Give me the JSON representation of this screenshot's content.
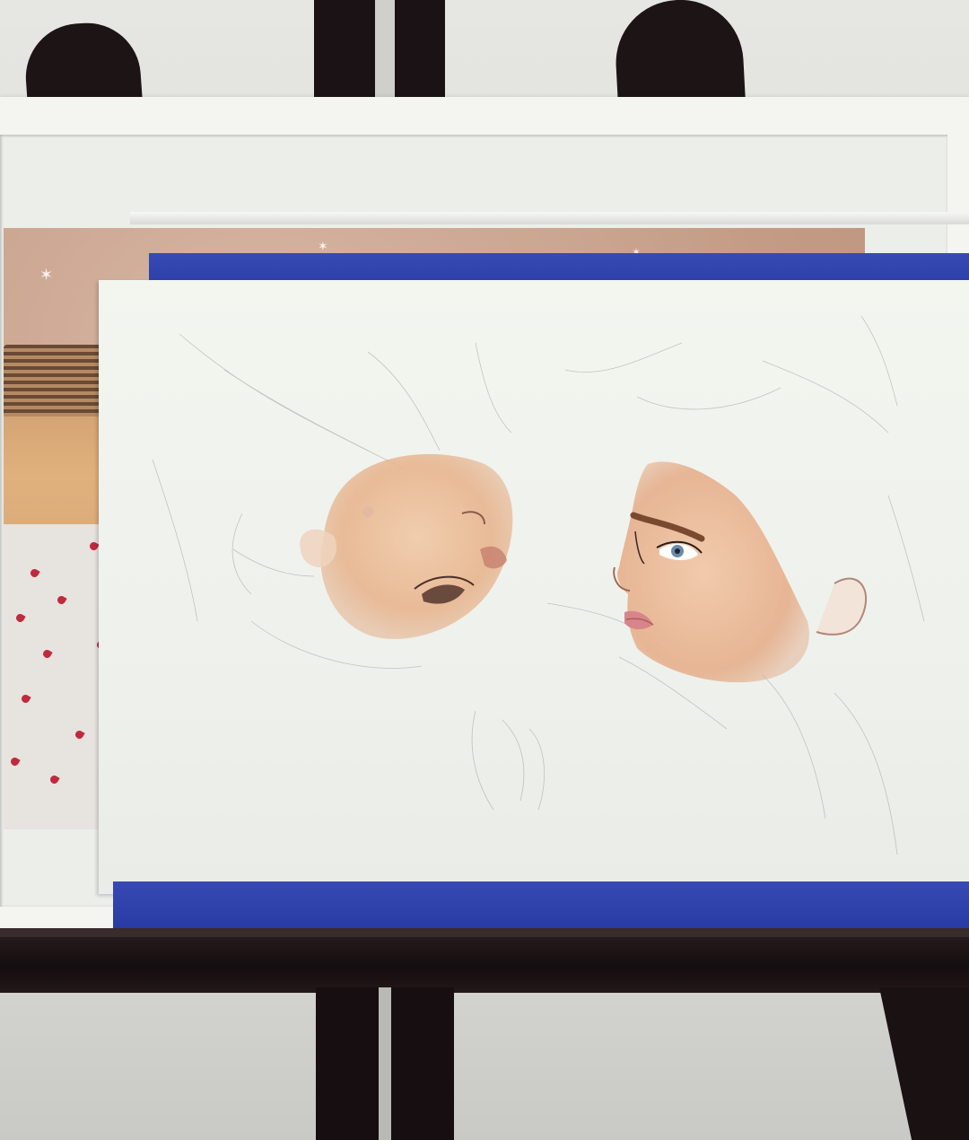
{
  "scene": {
    "subject": "watercolor-portrait-on-easel",
    "colors": {
      "tape": "#2b3fb0",
      "paper": "#f1f3ee",
      "skin": "#e8b894",
      "easel": "#1a1214",
      "frame": "#f4f4f1",
      "petals": "#c02a3e"
    }
  }
}
